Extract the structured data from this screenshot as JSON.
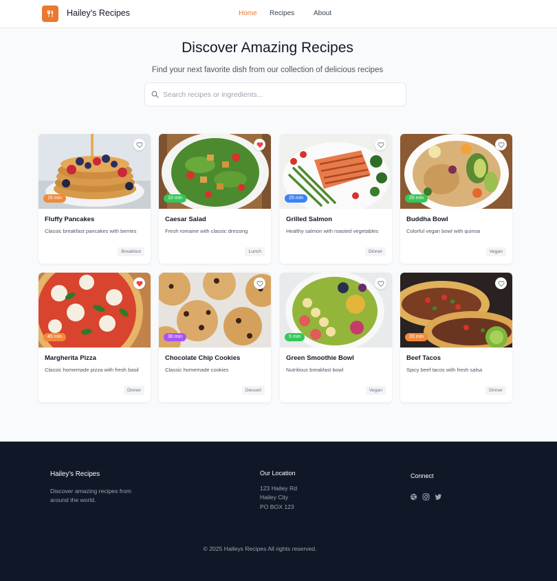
{
  "header": {
    "brand": "Hailey's Recipes",
    "nav": [
      {
        "label": "Home",
        "active": true
      },
      {
        "label": "Recipes",
        "active": false
      },
      {
        "label": "About",
        "active": false
      }
    ]
  },
  "hero": {
    "title": "Discover Amazing Recipes",
    "subtitle": "Find your next favorite dish from our collection of delicious recipes",
    "search_placeholder": "Search recipes or ingredients...",
    "search_value": ""
  },
  "colors": {
    "accent": "#e8792e",
    "time_orange": "#f08a3a",
    "time_green": "#34c759",
    "time_blue": "#3b82f6",
    "time_purple": "#a855f7",
    "heart_red": "#ef4444",
    "footer_bg": "#101828"
  },
  "recipes": [
    {
      "title": "Fluffy Pancakes",
      "description": "Classic breakfast pancakes with berries",
      "time": "15 min",
      "tag": "Breakfast",
      "favorite": false,
      "time_color": "orange",
      "image": "pancakes"
    },
    {
      "title": "Caesar Salad",
      "description": "Fresh romaine with classic dressing",
      "time": "10 min",
      "tag": "Lunch",
      "favorite": true,
      "time_color": "green",
      "image": "salad"
    },
    {
      "title": "Grilled Salmon",
      "description": "Healthy salmon with roasted vegetables",
      "time": "25 min",
      "tag": "Dinner",
      "favorite": false,
      "time_color": "blue",
      "image": "salmon"
    },
    {
      "title": "Buddha Bowl",
      "description": "Colorful vegan bowl with quinoa",
      "time": "20 min",
      "tag": "Vegan",
      "favorite": false,
      "time_color": "green",
      "image": "bowl"
    },
    {
      "title": "Margherita Pizza",
      "description": "Classic homemade pizza with fresh basil",
      "time": "45 min",
      "tag": "Dinner",
      "favorite": true,
      "time_color": "orange",
      "image": "pizza"
    },
    {
      "title": "Chocolate Chip Cookies",
      "description": "Classic homemade cookies",
      "time": "30 min",
      "tag": "Dessert",
      "favorite": false,
      "time_color": "purple",
      "image": "cookies"
    },
    {
      "title": "Green Smoothie Bowl",
      "description": "Nutritious breakfast bowl",
      "time": "5 min",
      "tag": "Vegan",
      "favorite": false,
      "time_color": "green",
      "image": "smoothie"
    },
    {
      "title": "Beef Tacos",
      "description": "Spicy beef tacos with fresh salsa",
      "time": "20 min",
      "tag": "Dinner",
      "favorite": false,
      "time_color": "orange",
      "image": "tacos"
    }
  ],
  "footer": {
    "brand": "Hailey's Recipes",
    "tagline_1": "Discover amazing recipes from",
    "tagline_2": "around the world.",
    "location_title": "Our Location",
    "address_1": "123 Hailey Rd",
    "address_2": "Hailey City",
    "address_3": "PO BOX 123",
    "connect_title": "Connect",
    "social": [
      "dribbble-icon",
      "instagram-icon",
      "twitter-icon"
    ],
    "copyright": "© 2025 Haileys Recipes All rights reserved."
  }
}
